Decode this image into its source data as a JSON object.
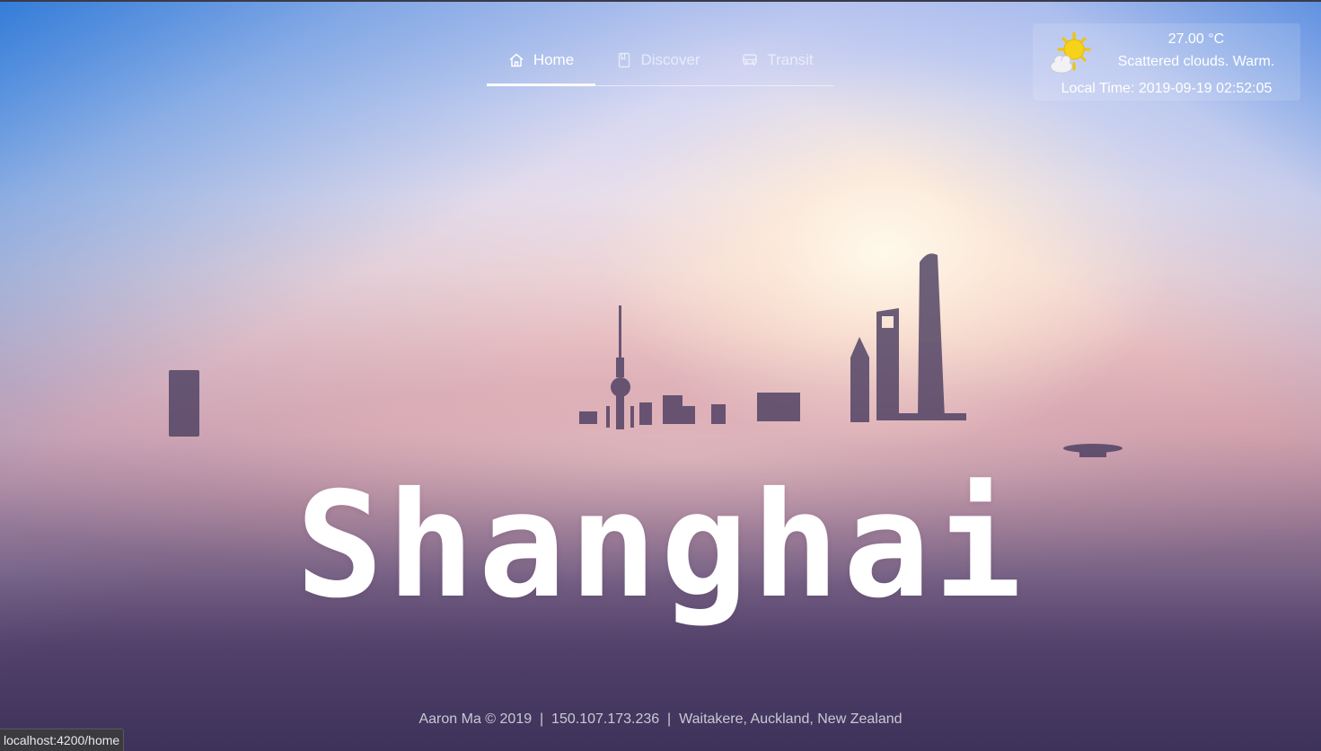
{
  "nav": {
    "tabs": [
      {
        "label": "Home",
        "icon": "home-icon",
        "active": true
      },
      {
        "label": "Discover",
        "icon": "bookmark-icon",
        "active": false
      },
      {
        "label": "Transit",
        "icon": "bus-icon",
        "active": false
      }
    ]
  },
  "weather": {
    "icon": "partly-cloudy-icon",
    "temperature": "27.00 °C",
    "description": "Scattered clouds. Warm.",
    "local_time": "Local Time: 2019-09-19 02:52:05"
  },
  "hero": {
    "city": "Shanghai"
  },
  "footer": {
    "text": "Aaron Ma © 2019  |  150.107.173.236  |  Waitakere, Auckland, New Zealand"
  },
  "status_bar": {
    "url": "localhost:4200/home"
  }
}
